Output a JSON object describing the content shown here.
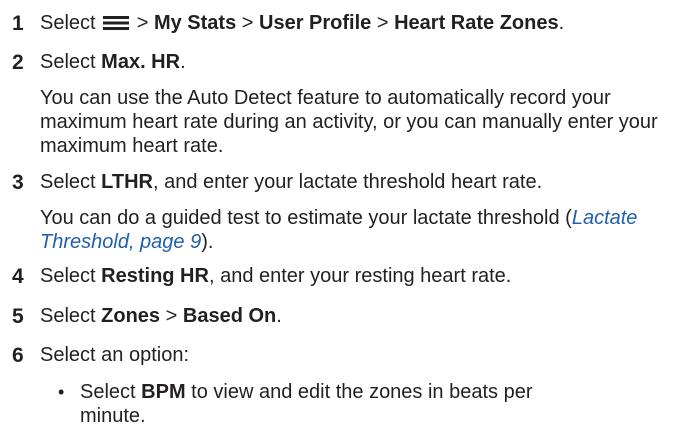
{
  "steps": [
    {
      "number": "1",
      "prefix": "Select",
      "sep1": ">",
      "item1": "My Stats",
      "sep2": ">",
      "item2": "User Profile",
      "sep3": ">",
      "item3": "Heart Rate Zones",
      "end": ".",
      "icon": "menu-icon"
    },
    {
      "number": "2",
      "prefix": "Select",
      "item": "Max. HR",
      "end": ".",
      "note": "You can use the Auto Detect feature to automatically record your maximum heart rate during an activity, or you can manually enter your maximum heart rate."
    },
    {
      "number": "3",
      "prefix": "Select",
      "item": "LTHR",
      "rest": ", and enter your lactate threshold heart rate.",
      "note_before": "You can do a guided test to estimate your lactate threshold (",
      "link_text": "Lactate Threshold",
      "link_page": ", page 9",
      "note_after": ")."
    },
    {
      "number": "4",
      "prefix": "Select",
      "item": "Resting HR",
      "rest": ", and enter your resting heart rate."
    },
    {
      "number": "5",
      "prefix": "Select",
      "item1": "Zones",
      "sep": ">",
      "item2": "Based On",
      "end": "."
    },
    {
      "number": "6",
      "text": "Select an option:",
      "bullets": [
        {
          "marker": "•",
          "prefix": "Select",
          "item": "BPM",
          "rest": "to view and edit the zones in beats per minute."
        }
      ]
    }
  ]
}
